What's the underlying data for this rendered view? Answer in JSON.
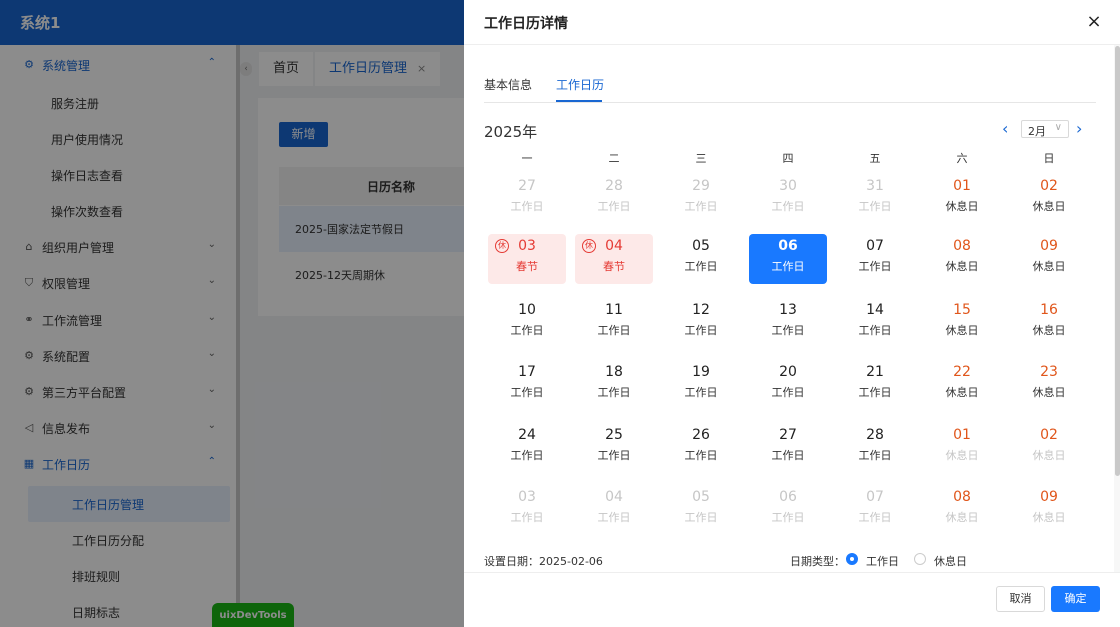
{
  "app": {
    "title": "系统1"
  },
  "sidebar": {
    "groups": [
      {
        "icon": "⚙",
        "label": "系统管理",
        "arrow": "⌃"
      },
      {
        "icon": "⌂",
        "label": "组织用户管理",
        "arrow": "⌄"
      },
      {
        "icon": "⛉",
        "label": "权限管理",
        "arrow": "⌄"
      },
      {
        "icon": "⚭",
        "label": "工作流管理",
        "arrow": "⌄"
      },
      {
        "icon": "⚙",
        "label": "系统配置",
        "arrow": "⌄"
      },
      {
        "icon": "⚙",
        "label": "第三方平台配置",
        "arrow": "⌄"
      },
      {
        "icon": "◁",
        "label": "信息发布",
        "arrow": "⌄"
      },
      {
        "icon": "▦",
        "label": "工作日历",
        "arrow": "⌃"
      }
    ],
    "system_items": [
      "服务注册",
      "用户使用情况",
      "操作日志查看",
      "操作次数查看"
    ],
    "calendar_items": [
      "工作日历管理",
      "工作日历分配",
      "排班规则",
      "日期标志"
    ]
  },
  "tabs": {
    "scroll": "‹",
    "home": "首页",
    "calendar": "工作日历管理",
    "close": "×"
  },
  "content": {
    "add_button": "新增",
    "table_header": "日历名称",
    "rows": [
      "2025-国家法定节假日",
      "2025-12天周期休"
    ]
  },
  "devtools": "uixDevTools",
  "drawer": {
    "title": "工作日历详情",
    "close": "×",
    "tabs": [
      "基本信息",
      "工作日历"
    ],
    "year": "2025年",
    "month": "2月",
    "month_arrow": "∨",
    "prev": "‹",
    "next": "›",
    "weekdays": [
      "一",
      "二",
      "三",
      "四",
      "五",
      "六",
      "日"
    ],
    "days": [
      [
        {
          "d": "27",
          "l": "工作日",
          "t": "other"
        },
        {
          "d": "28",
          "l": "工作日",
          "t": "other"
        },
        {
          "d": "29",
          "l": "工作日",
          "t": "other"
        },
        {
          "d": "30",
          "l": "工作日",
          "t": "other"
        },
        {
          "d": "31",
          "l": "工作日",
          "t": "other"
        },
        {
          "d": "01",
          "l": "休息日",
          "t": "weekend"
        },
        {
          "d": "02",
          "l": "休息日",
          "t": "weekend"
        }
      ],
      [
        {
          "d": "03",
          "l": "春节",
          "t": "holiday",
          "b": "休"
        },
        {
          "d": "04",
          "l": "春节",
          "t": "holiday",
          "b": "休"
        },
        {
          "d": "05",
          "l": "工作日",
          "t": ""
        },
        {
          "d": "06",
          "l": "工作日",
          "t": "selected"
        },
        {
          "d": "07",
          "l": "工作日",
          "t": ""
        },
        {
          "d": "08",
          "l": "休息日",
          "t": "weekend"
        },
        {
          "d": "09",
          "l": "休息日",
          "t": "weekend"
        }
      ],
      [
        {
          "d": "10",
          "l": "工作日",
          "t": ""
        },
        {
          "d": "11",
          "l": "工作日",
          "t": ""
        },
        {
          "d": "12",
          "l": "工作日",
          "t": ""
        },
        {
          "d": "13",
          "l": "工作日",
          "t": ""
        },
        {
          "d": "14",
          "l": "工作日",
          "t": ""
        },
        {
          "d": "15",
          "l": "休息日",
          "t": "weekend"
        },
        {
          "d": "16",
          "l": "休息日",
          "t": "weekend"
        }
      ],
      [
        {
          "d": "17",
          "l": "工作日",
          "t": ""
        },
        {
          "d": "18",
          "l": "工作日",
          "t": ""
        },
        {
          "d": "19",
          "l": "工作日",
          "t": ""
        },
        {
          "d": "20",
          "l": "工作日",
          "t": ""
        },
        {
          "d": "21",
          "l": "工作日",
          "t": ""
        },
        {
          "d": "22",
          "l": "休息日",
          "t": "weekend"
        },
        {
          "d": "23",
          "l": "休息日",
          "t": "weekend"
        }
      ],
      [
        {
          "d": "24",
          "l": "工作日",
          "t": ""
        },
        {
          "d": "25",
          "l": "工作日",
          "t": ""
        },
        {
          "d": "26",
          "l": "工作日",
          "t": ""
        },
        {
          "d": "27",
          "l": "工作日",
          "t": ""
        },
        {
          "d": "28",
          "l": "工作日",
          "t": ""
        },
        {
          "d": "01",
          "l": "休息日",
          "t": "other weekend"
        },
        {
          "d": "02",
          "l": "休息日",
          "t": "other weekend"
        }
      ],
      [
        {
          "d": "03",
          "l": "工作日",
          "t": "other"
        },
        {
          "d": "04",
          "l": "工作日",
          "t": "other"
        },
        {
          "d": "05",
          "l": "工作日",
          "t": "other"
        },
        {
          "d": "06",
          "l": "工作日",
          "t": "other"
        },
        {
          "d": "07",
          "l": "工作日",
          "t": "other"
        },
        {
          "d": "08",
          "l": "休息日",
          "t": "other weekend"
        },
        {
          "d": "09",
          "l": "休息日",
          "t": "other weekend"
        }
      ]
    ],
    "setting_date": "设置日期：2025-02-06",
    "date_type_label": "日期类型：",
    "type_workday": "工作日",
    "type_restday": "休息日",
    "cancel": "取消",
    "ok": "确定"
  }
}
